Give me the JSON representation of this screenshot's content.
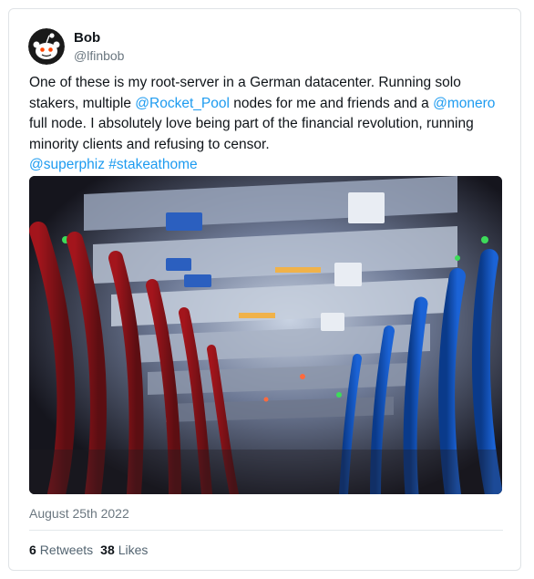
{
  "user": {
    "name": "Bob",
    "handle": "@lfinbob"
  },
  "tweet": {
    "text_1": "One of these is my root-server in a German datacenter. Running solo stakers, multiple ",
    "mention_1": "@Rocket_Pool",
    "text_2": " nodes for me and friends and a ",
    "mention_2": "@monero",
    "text_3": " full node. I absolutely love being part of the financial revolution, running minority clients and refusing to censor.",
    "mention_3": "@superphiz",
    "hashtag": "#stakeathome",
    "date": "August 25th 2022"
  },
  "stats": {
    "retweets_count": "6",
    "retweets_label": "Retweets",
    "likes_count": "38",
    "likes_label": "Likes"
  },
  "colors": {
    "link": "#1d9bf0",
    "muted": "#6b7780"
  },
  "icons": {
    "avatar": "reddit-alien-avatar",
    "media": "server-rack-photo"
  }
}
